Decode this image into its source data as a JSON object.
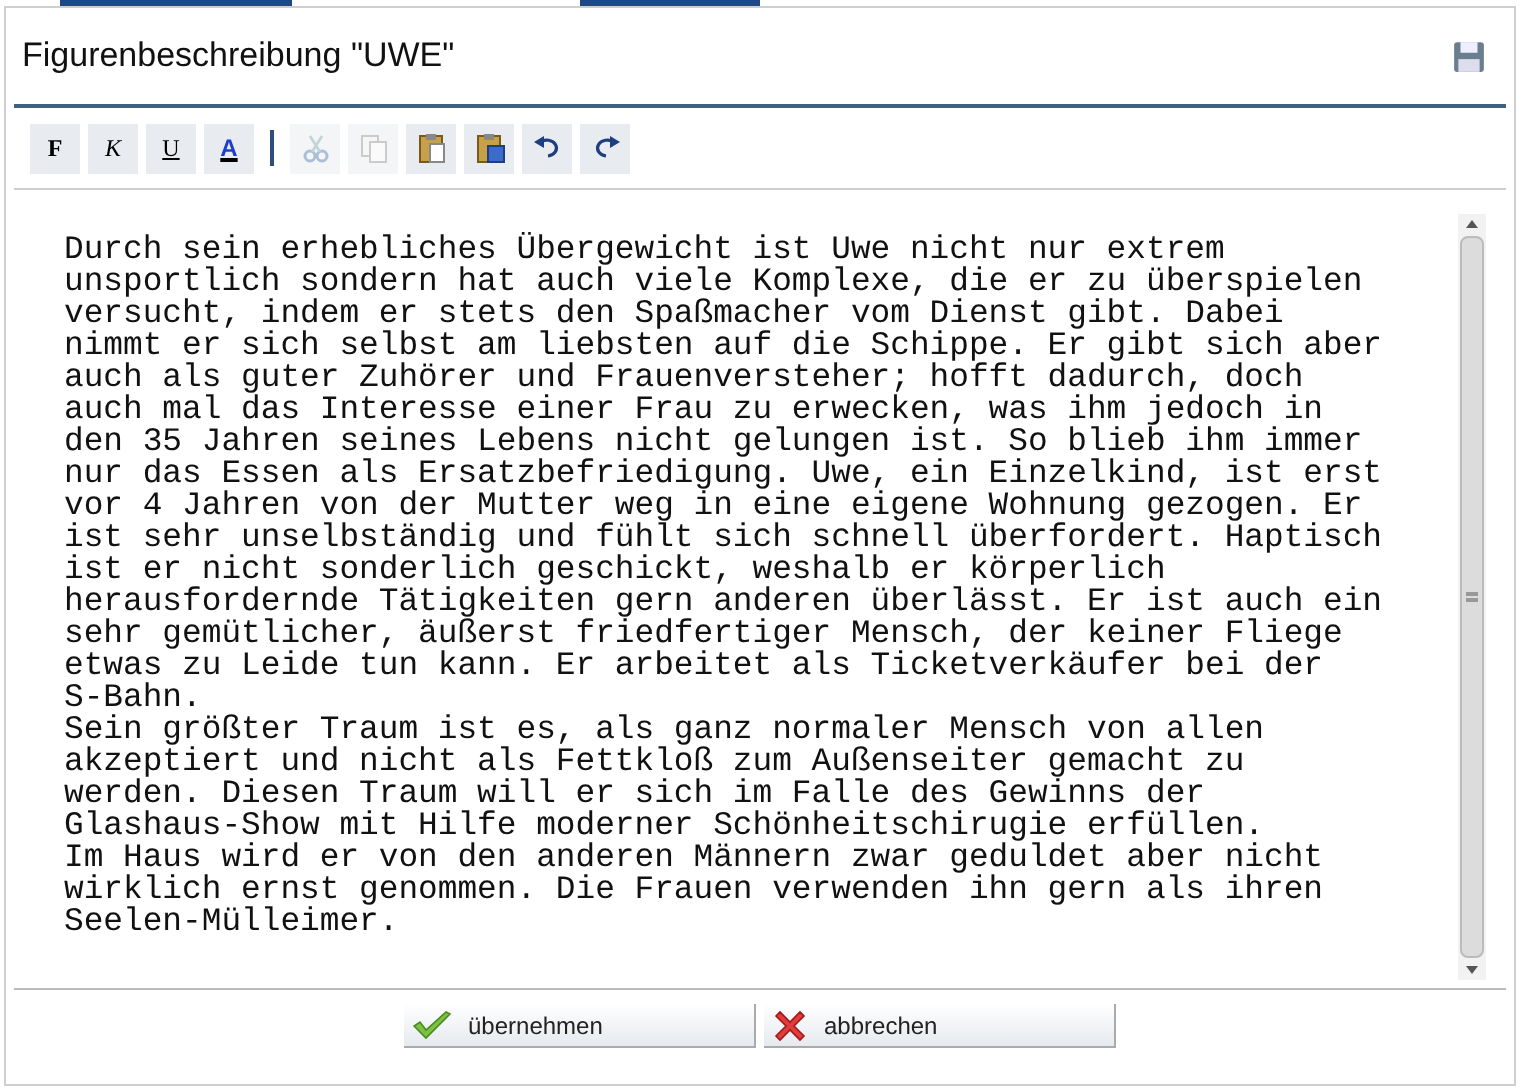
{
  "title": "Figurenbeschreibung \"UWE\"",
  "toolbar": [
    {
      "kind": "bold",
      "label": "F",
      "disabled": false
    },
    {
      "kind": "italic",
      "label": "K",
      "disabled": false
    },
    {
      "kind": "underline",
      "label": "U",
      "disabled": false
    },
    {
      "kind": "fontcolor",
      "label": "A",
      "disabled": false
    },
    {
      "kind": "separator"
    },
    {
      "kind": "cut",
      "disabled": true
    },
    {
      "kind": "copy",
      "disabled": true
    },
    {
      "kind": "paste",
      "disabled": false
    },
    {
      "kind": "pasteword",
      "disabled": false
    },
    {
      "kind": "undo",
      "disabled": false
    },
    {
      "kind": "redo",
      "disabled": false
    }
  ],
  "text_lines": [
    "Durch sein erhebliches Übergewicht ist Uwe nicht nur extrem",
    "unsportlich sondern hat auch viele Komplexe, die er zu überspielen",
    "versucht, indem er stets den Spaßmacher vom Dienst gibt. Dabei",
    "nimmt er sich selbst am liebsten auf die Schippe. Er gibt sich aber",
    "auch als guter Zuhörer und Frauenversteher; hofft dadurch, doch",
    "auch mal das Interesse einer Frau zu erwecken, was ihm jedoch in",
    "den 35 Jahren seines Lebens nicht gelungen ist. So blieb ihm immer",
    "nur das Essen als Ersatzbefriedigung. Uwe, ein Einzelkind, ist erst",
    "vor 4 Jahren von der Mutter weg in eine eigene Wohnung gezogen. Er",
    "ist sehr unselbständig und fühlt sich schnell überfordert. Haptisch",
    "ist er nicht sonderlich geschickt, weshalb er körperlich",
    "herausfordernde Tätigkeiten gern anderen überlässt. Er ist auch ein",
    "sehr gemütlicher, äußerst friedfertiger Mensch, der keiner Fliege",
    "etwas zu Leide tun kann. Er arbeitet als Ticketverkäufer bei der",
    "S-Bahn.",
    "Sein größter Traum ist es, als ganz normaler Mensch von allen",
    "akzeptiert und nicht als Fettkloß zum Außenseiter gemacht zu",
    "werden. Diesen Traum will er sich im Falle des Gewinns der",
    "Glashaus-Show mit Hilfe moderner Schönheitschirugie erfüllen.",
    "Im Haus wird er von den anderen Männern zwar geduldet aber nicht",
    "wirklich ernst genommen. Die Frauen verwenden ihn gern als ihren",
    "Seelen-Mülleimer."
  ],
  "buttons": [
    {
      "kind": "confirm",
      "label": "übernehmen"
    },
    {
      "kind": "cancel",
      "label": "abbrechen"
    }
  ]
}
